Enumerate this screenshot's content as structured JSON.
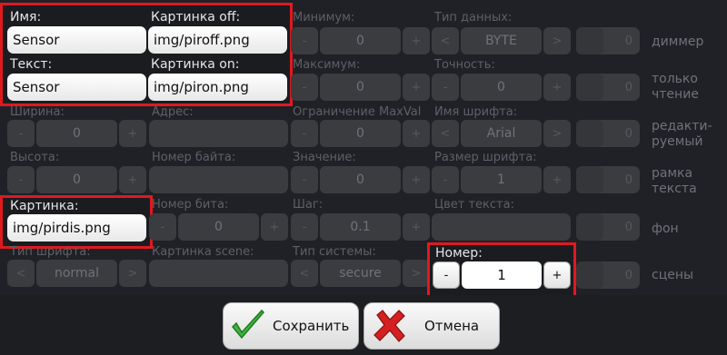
{
  "left_group": {
    "name_label": "Имя:",
    "name_value": "Sensor",
    "off_label": "Картинка off:",
    "off_value": "img/piroff.png",
    "text_label": "Текст:",
    "text_value": "Sensor",
    "on_label": "Картинка on:",
    "on_value": "img/piron.png"
  },
  "grid": {
    "width_label": "Ширина:",
    "width_value": "0",
    "address_label": "Адрес:",
    "height_label": "Высота:",
    "height_value": "0",
    "byte_label": "Номер байта:",
    "picture_label": "Картинка:",
    "picture_value": "img/pirdis.png",
    "bit_label": "Номер бита:",
    "bit_value": "0",
    "font_type_label": "Тип шрифта:",
    "font_type_value": "normal",
    "scene_pic_label": "Картинка scene:"
  },
  "mid": {
    "min_label": "Минимум:",
    "min_value": "0",
    "max_label": "Максимум:",
    "max_value": "0",
    "limit_label": "Ограничение MaxVal",
    "limit_value": "0",
    "value_label": "Значение:",
    "value_value": "0",
    "step_label": "Шаг:",
    "step_value": "0.1",
    "system_label": "Тип системы:",
    "system_value": "secure"
  },
  "right": {
    "datatype_label": "Тип данных:",
    "datatype_value": "BYTE",
    "precision_label": "Точность:",
    "precision_value": "0",
    "fontname_label": "Имя шрифта:",
    "fontname_value": "Arial",
    "fontsize_label": "Размер шрифта:",
    "fontsize_value": "1",
    "textcolor_label": "Цвет текста:",
    "number_label": "Номер:",
    "number_value": "1"
  },
  "side": {
    "dimmer": "диммер",
    "readonly": "только чтение",
    "editable": "редакти-руемый",
    "frame": "рамка текста",
    "background": "фон",
    "scenes": "сцены"
  },
  "toggles": [
    "0",
    "0",
    "0",
    "0",
    "0",
    "0"
  ],
  "buttons": {
    "save": "Сохранить",
    "cancel": "Отмена"
  },
  "colors": {
    "highlight": "#e0191f",
    "save_icon": "#3cb43c",
    "cancel_icon": "#d42020"
  }
}
